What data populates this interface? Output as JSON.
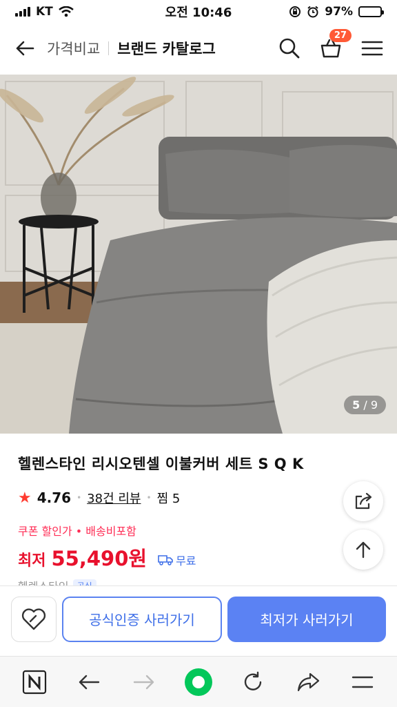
{
  "status_bar": {
    "carrier": "KT",
    "time": "오전 10:46",
    "battery": "97%",
    "battery_level": 0.97
  },
  "header": {
    "back_icon": "arrow-left-icon",
    "crumb": "가격비교",
    "title": "브랜드 카탈로그",
    "cart_count": "27"
  },
  "gallery": {
    "current": "5",
    "total": "9",
    "separator": "/"
  },
  "product": {
    "title": "헬렌스타인 리시오텐셀 이불커버 세트 S Q K",
    "rating": "4.76",
    "reviews": "38건 리뷰",
    "wishlist": "찜 5",
    "coupon_note": "쿠폰 할인가 • 배송비포함",
    "price_label": "최저",
    "price": "55,490원",
    "shipping": "무료",
    "brand": "헬렌스타인",
    "brand_tag": "공식"
  },
  "actions": {
    "official_button": "공식인증 사러가기",
    "lowest_button": "최저가 사러가기"
  },
  "colors": {
    "accent_blue": "#5b82f3",
    "price_red": "#e8112d",
    "coupon_pink": "#ff2d55",
    "badge_orange": "#ff5a36",
    "naver_green": "#03c75a"
  }
}
